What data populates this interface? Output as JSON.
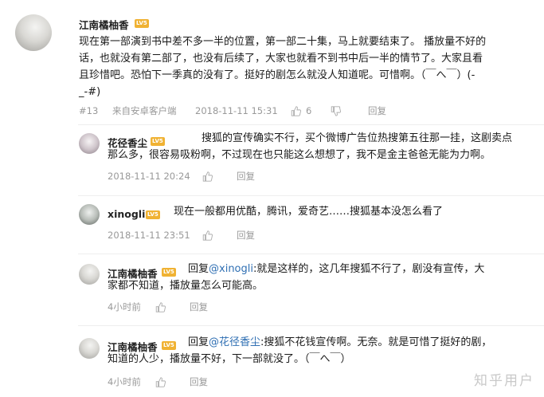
{
  "main_comment": {
    "author": "江南橘柚香",
    "badge": "LV5",
    "text_lines": [
      "现在第一部演到书中差不多一半的位置，第一部二十集，马上就要结束了。 播放量不好的",
      "话，也就没有第二部了，也没有后续了，大家也就看不到书中后一半的情节了。大家且看",
      "且珍惜吧。恐怕下一季真的没有了。挺好的剧怎么就没人知道呢。可惜啊。（￣へ￣）(-",
      "_-#)"
    ],
    "floor": "#13",
    "source": "来自安卓客户端",
    "time": "2018-11-11 15:31",
    "likes": "6",
    "reply_label": "回复"
  },
  "replies": [
    {
      "author": "花径香尘",
      "badge": "LV5",
      "text_lines": [
        "搜狐的宣传确实不行，买个微博广告位热搜第五往那一挂，这剧卖点",
        "那么多，很容易吸粉啊，不过现在也只能这么想想了，我不是金主爸爸无能为力啊。"
      ],
      "time": "2018-11-11 20:24",
      "reply_label": "回复"
    },
    {
      "author": "xinogli",
      "badge": "LV5",
      "text_lines": [
        "现在一般都用优酷，腾讯，爱奇艺……搜狐基本没怎么看了"
      ],
      "time": "2018-11-11 23:51",
      "reply_label": "回复"
    },
    {
      "author": "江南橘柚香",
      "badge": "LV5",
      "reply_prefix": "回复",
      "reply_to": "@xinogli",
      "text_first": ":就是这样的，这几年搜狐不行了，剧没有宣传，大",
      "text_second": "家都不知道，播放量怎么可能高。",
      "time": "4小时前",
      "reply_label": "回复"
    },
    {
      "author": "江南橘柚香",
      "badge": "LV5",
      "reply_prefix": "回复",
      "reply_to": "@花径香尘",
      "text_first": ":搜狐不花钱宣传啊。无奈。就是可惜了挺好的剧，",
      "text_second": "知道的人少，播放量不好，下一部就没了。（￣へ￣）",
      "time": "4小时前",
      "reply_label": "回复"
    }
  ],
  "watermark": "知乎用户",
  "colors": {
    "badge": "#f0b233",
    "link": "#2f6fb3",
    "meta": "#999999"
  }
}
